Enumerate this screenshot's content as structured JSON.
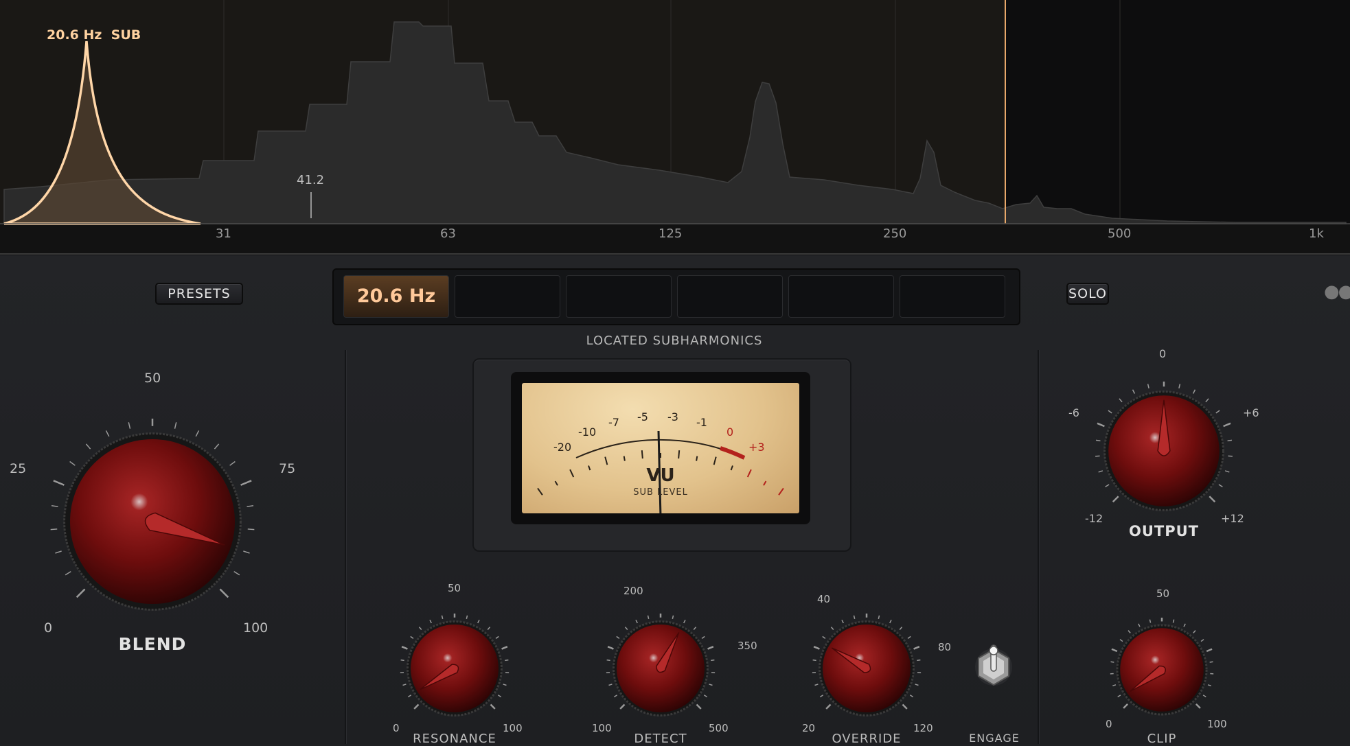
{
  "spectrum": {
    "peak_label": "20.6 Hz  SUB",
    "marker_label": "41.2",
    "freq_labels": [
      "31",
      "63",
      "125",
      "250",
      "500",
      "1k"
    ],
    "cutoff_color": "#e8a86a"
  },
  "toolbar": {
    "presets_label": "PRESETS",
    "solo_label": "SOLO",
    "more_icon": "more-dots-icon",
    "slots": [
      "20.6 Hz",
      "",
      "",
      "",
      "",
      ""
    ]
  },
  "meter": {
    "section_title": "LOCATED SUBHARMONICS",
    "scale": [
      "-20",
      "-10",
      "-7",
      "-5",
      "-3",
      "-1",
      "0",
      "+3"
    ],
    "title": "VU",
    "subtitle": "SUB LEVEL",
    "needle_db": -4.6
  },
  "knobs": {
    "blend": {
      "label": "BLEND",
      "scale": [
        "0",
        "25",
        "50",
        "75",
        "100"
      ],
      "value_pct": 0.9
    },
    "output": {
      "label": "OUTPUT",
      "scale": [
        "-12",
        "-6",
        "0",
        "+6",
        "+12"
      ],
      "value_pct": 0.5
    },
    "resonance": {
      "label": "RESONANCE",
      "scale": [
        "0",
        "50",
        "100"
      ],
      "value_pct": 0.05
    },
    "detect": {
      "label": "DETECT",
      "scale": [
        "100",
        "200",
        "350",
        "500"
      ],
      "value_pct": 0.6
    },
    "override": {
      "label": "OVERRIDE",
      "scale": [
        "20",
        "40",
        "80",
        "120"
      ],
      "value_pct": 0.28
    },
    "clip": {
      "label": "CLIP",
      "scale": [
        "0",
        "50",
        "100"
      ],
      "value_pct": 0.04
    }
  },
  "engage": {
    "label": "ENGAGE"
  },
  "colors": {
    "accent": "#ffc99a",
    "knob": "#7a1010",
    "panel": "#1f2023"
  }
}
